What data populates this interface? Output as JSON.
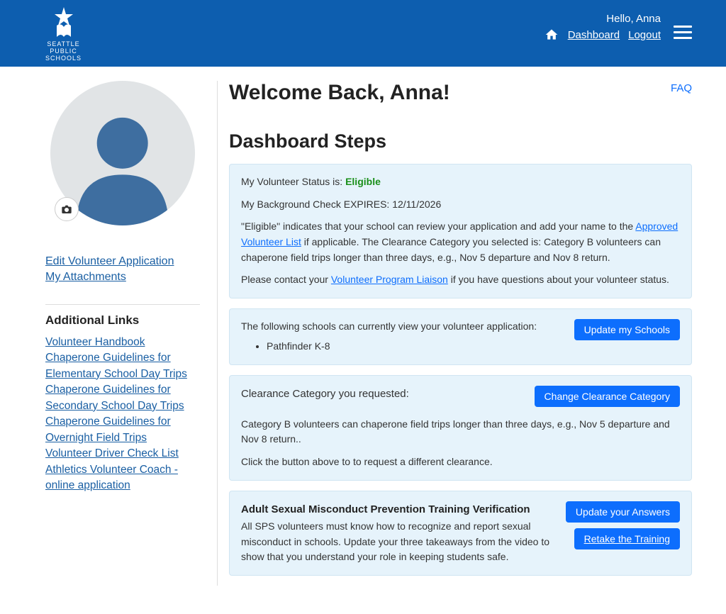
{
  "header": {
    "logo_line1": "SEATTLE",
    "logo_line2": "PUBLIC",
    "logo_line3": "SCHOOLS",
    "greeting": "Hello, Anna",
    "dashboard": "Dashboard",
    "logout": "Logout"
  },
  "sidebar": {
    "edit_app": "Edit Volunteer Application",
    "my_attachments": "My Attachments",
    "additional_heading": "Additional Links",
    "links": {
      "handbook": "Volunteer Handbook",
      "elem": "Chaperone Guidelines for Elementary School Day Trips",
      "sec": "Chaperone Guidelines for Secondary School Day Trips",
      "overnight": "Chaperone Guidelines for Overnight Field Trips",
      "driver": "Volunteer Driver Check List",
      "athletics": "Athletics Volunteer Coach - online application"
    }
  },
  "main": {
    "faq": "FAQ",
    "welcome": "Welcome Back, Anna!",
    "steps_heading": "Dashboard Steps"
  },
  "status_card": {
    "status_label": "My Volunteer Status is: ",
    "status_value": "Eligible",
    "expires": "My Background Check EXPIRES: 12/11/2026",
    "p1a": "\"Eligible\" indicates that your school can review your application and add your name to the ",
    "p1_link": "Approved Volunteer List",
    "p1b": " if applicable. The Clearance Category you selected is: Category B volunteers can chaperone field trips longer than three days, e.g., Nov 5 departure and Nov 8 return.",
    "p2a": "Please contact your ",
    "p2_link": "Volunteer Program Liaison",
    "p2b": " if you have questions about your volunteer status."
  },
  "schools_card": {
    "intro": "The following schools can currently view your volunteer application:",
    "school1": "Pathfinder K-8",
    "button": "Update my Schools"
  },
  "clearance_card": {
    "heading": "Clearance Category you requested:",
    "button": "Change Clearance Category",
    "p1": "Category B volunteers can chaperone field trips longer than three days, e.g., Nov 5 departure and Nov 8 return..",
    "p2": "Click the button above to to request a different clearance."
  },
  "training_card": {
    "heading": "Adult Sexual Misconduct Prevention Training Verification",
    "desc": "All SPS volunteers must know how to recognize and report sexual misconduct in schools. Update your three takeaways from the video to show that you understand your role in keeping students safe.",
    "btn1": "Update your Answers",
    "btn2": "Retake the Training"
  }
}
